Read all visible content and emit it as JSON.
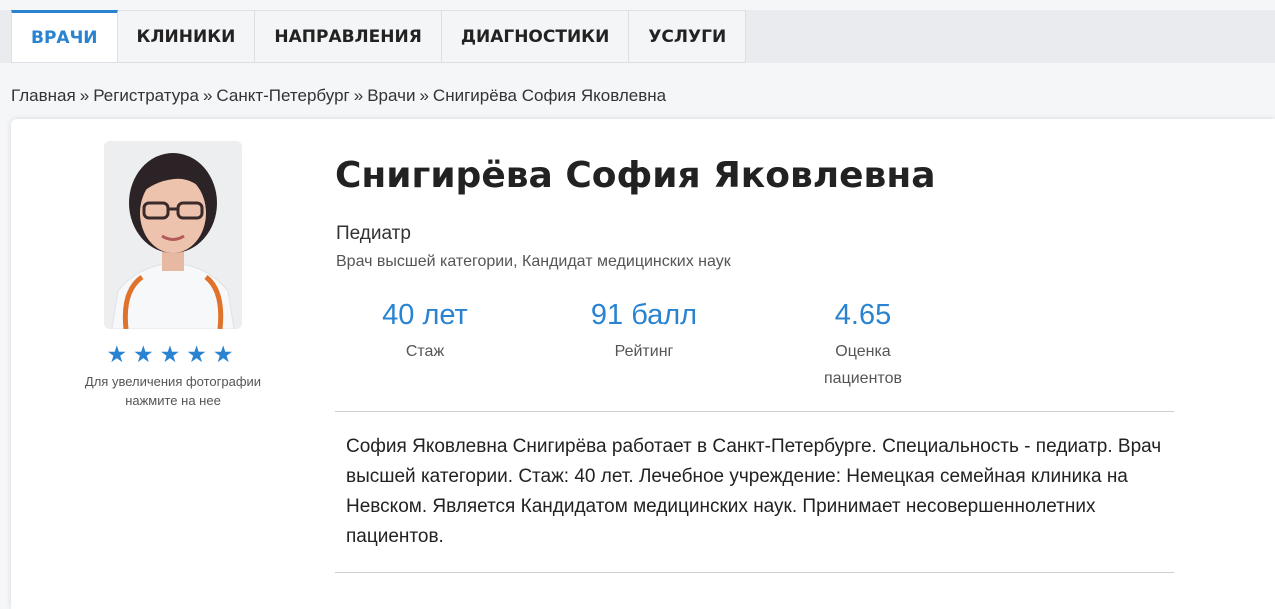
{
  "nav": {
    "tabs": [
      {
        "label": "ВРАЧИ"
      },
      {
        "label": "КЛИНИКИ"
      },
      {
        "label": "НАПРАВЛЕНИЯ"
      },
      {
        "label": "ДИАГНОСТИКИ"
      },
      {
        "label": "УСЛУГИ"
      }
    ]
  },
  "breadcrumb": {
    "items": [
      "Главная",
      "Регистратура",
      "Санкт-Петербург",
      "Врачи",
      "Снигирёва София Яковлевна"
    ],
    "separator": "»"
  },
  "doctor": {
    "name": "Снигирёва София Яковлевна",
    "specialty": "Педиатр",
    "category": "Врач высшей категории, Кандидат медицинских наук",
    "rating_stars": 5,
    "stars": "★★★★★",
    "photo_hint": "Для увеличения фотографии нажмите на нее",
    "stats": [
      {
        "value": "40 лет",
        "label": "Стаж"
      },
      {
        "value": "91 балл",
        "label": "Рейтинг"
      },
      {
        "value": "4.65",
        "label": "Оценка пациентов"
      }
    ],
    "description": "София Яковлевна Снигирёва работает в Санкт-Петербурге. Специальность - педиатр. Врач высшей категории. Стаж: 40 лет. Лечебное учреждение: Немецкая семейная клиника на Невском. Является Кандидатом медицинских наук. Принимает несовершеннолетних пациентов."
  },
  "colors": {
    "accent": "#2a83d0",
    "tab_bar": "#e9ebee"
  }
}
